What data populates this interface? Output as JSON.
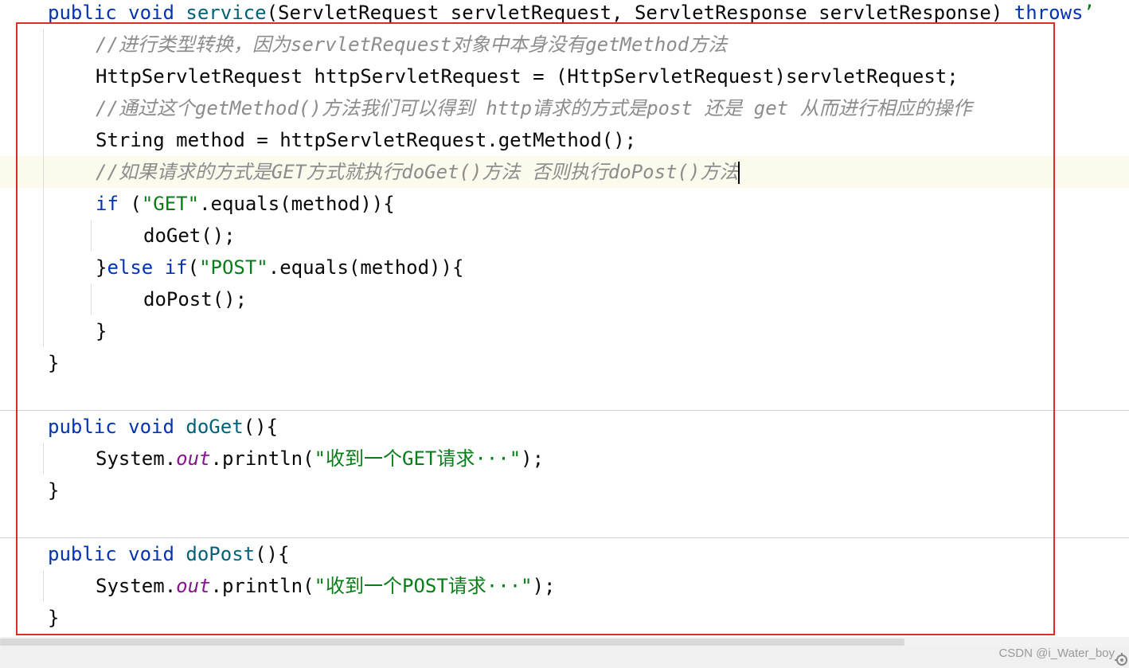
{
  "code": {
    "line_service": {
      "kw1": "public",
      "kw2": "void",
      "fn": "service",
      "params": "(ServletRequest servletRequest, ServletResponse servletResponse) ",
      "kw3": "throws",
      "tail": "’"
    },
    "comment_1": "//进行类型转换，因为servletRequest对象中本身没有getMethod方法",
    "cast_line": "HttpServletRequest httpServletRequest = (HttpServletRequest)servletRequest;",
    "comment_2": "//通过这个getMethod()方法我们可以得到 http请求的方式是post 还是 get 从而进行相应的操作",
    "method_line": "String method = httpServletRequest.getMethod();",
    "comment_3": "//如果请求的方式是GET方式就执行doGet()方法 否则执行doPost()方法",
    "if_line": {
      "kw": "if",
      "pre": " (",
      "str": "\"GET\"",
      "post": ".equals(method)){"
    },
    "call_doget": "doGet();",
    "else_line": {
      "pre": "}",
      "kw1": "else",
      "sp": " ",
      "kw2": "if",
      "open": "(",
      "str": "\"POST\"",
      "post": ".equals(method)){"
    },
    "call_dopost": "doPost();",
    "close_if": "}",
    "close_service": "}",
    "doget_decl": {
      "kw1": "public",
      "kw2": "void",
      "fn": "doGet",
      "rest": "(){"
    },
    "doget_print": {
      "pre": "System.",
      "field": "out",
      "mid": ".println(",
      "str": "\"收到一个GET请求···\"",
      "post": ");"
    },
    "close_doget": "}",
    "dopost_decl": {
      "kw1": "public",
      "kw2": "void",
      "fn": "doPost",
      "rest": "(){"
    },
    "dopost_print": {
      "pre": "System.",
      "field": "out",
      "mid": ".println(",
      "str": "\"收到一个POST请求···\"",
      "post": ");"
    },
    "close_dopost": "}"
  },
  "watermark": "CSDN @i_Water_boy",
  "colors": {
    "keyword": "#0033b3",
    "method_name": "#00627a",
    "string": "#067d17",
    "comment": "#8c8c8c",
    "static_field": "#871094",
    "current_line": "#fcfaed",
    "highlight_box": "#e02a2a"
  },
  "icons": {
    "bottom_right": "settings-gear-icon"
  }
}
